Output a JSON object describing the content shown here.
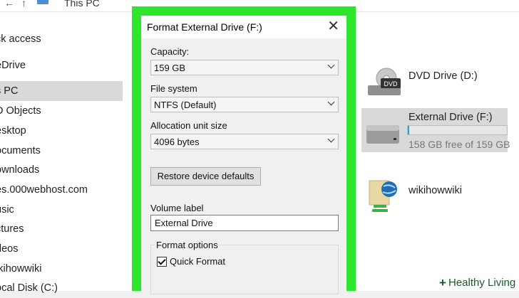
{
  "explorer": {
    "path": "This PC",
    "sidebar_items": [
      "ck access",
      "eDrive",
      "s PC",
      "D Objects",
      "esktop",
      "ocuments",
      "ownloads",
      "es.000webhost.com",
      "usic",
      "ctures",
      "deos",
      "ikihowwiki",
      "ocal Disk (C:)"
    ],
    "selected_index": 2,
    "drives": {
      "dvd": {
        "name": "DVD Drive (D:)",
        "icon_label": "DVD"
      },
      "external": {
        "name": "External Drive (F:)",
        "free": "158 GB free of 159 GB",
        "used_fraction": 0.006
      },
      "network": {
        "name": "wikihowwiki"
      }
    }
  },
  "dialog": {
    "title": "Format External Drive (F:)",
    "capacity_label": "Capacity:",
    "capacity_value": "159 GB",
    "filesystem_label": "File system",
    "filesystem_value": "NTFS (Default)",
    "alloc_label": "Allocation unit size",
    "alloc_value": "4096 bytes",
    "restore_button": "Restore device defaults",
    "volume_label": "Volume label",
    "volume_value": "External Drive",
    "format_options_label": "Format options",
    "quick_format_label": "Quick Format",
    "quick_format_checked": true
  },
  "watermark": {
    "text": "Healthy Living"
  },
  "colors": {
    "highlight_frame": "#2ee62e",
    "progress": "#26a0da",
    "selection": "#d9d9d9"
  }
}
